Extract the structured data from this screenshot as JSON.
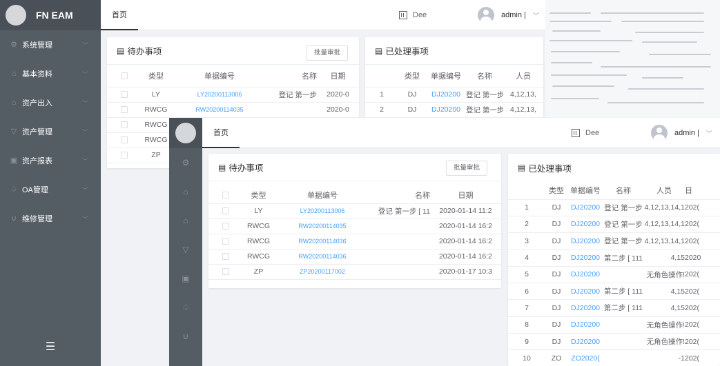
{
  "app": {
    "name": "FN EAM"
  },
  "sidebar": {
    "items": [
      {
        "label": "系统管理",
        "icon": "gear-icon"
      },
      {
        "label": "基本资料",
        "icon": "bag-icon"
      },
      {
        "label": "资产出入",
        "icon": "bag-out-icon"
      },
      {
        "label": "资产管理",
        "icon": "cart-icon"
      },
      {
        "label": "资产报表",
        "icon": "report-icon"
      },
      {
        "label": "OA管理",
        "icon": "bell-icon"
      },
      {
        "label": "维修管理",
        "icon": "magnet-icon"
      }
    ],
    "toggle_icon": "menu-fold-icon"
  },
  "header": {
    "tab": "首页",
    "dept": "Dee",
    "user": "admin |",
    "caret": "﹀"
  },
  "todo": {
    "title": "待办事项",
    "batch_button": "批量审批",
    "columns": [
      "类型",
      "单据编号",
      "名称",
      "日期"
    ],
    "rows": [
      {
        "type": "LY",
        "code": "LY20200113006",
        "name": "登记 第一步 [ 11",
        "date": "2020-01-14 11:2"
      },
      {
        "type": "RWCG",
        "code": "RW20200114035",
        "name": "",
        "date": "2020-01-14 16:2"
      },
      {
        "type": "RWCG",
        "code": "RW20200114036",
        "name": "",
        "date": "2020-01-14 16:2"
      },
      {
        "type": "RWCG",
        "code": "RW20200114036",
        "name": "",
        "date": "2020-01-14 16:2"
      },
      {
        "type": "ZP",
        "code": "ZP20200117002",
        "name": "",
        "date": "2020-01-17 10:3"
      }
    ],
    "back_rows": [
      {
        "type": "LY",
        "code": "LY20200113006",
        "name": "登记 第一步",
        "date": "2020-0"
      },
      {
        "type": "RWCG",
        "code": "RW20200114035",
        "name": "",
        "date": "2020-0"
      },
      {
        "type": "RWCG"
      },
      {
        "type": "RWCG"
      },
      {
        "type": "ZP"
      }
    ],
    "back_columns": [
      "类型",
      "单据编号",
      "名称",
      "日期"
    ]
  },
  "done": {
    "title": "已处理事项",
    "columns": [
      "类型",
      "单据编号",
      "名称",
      "人员",
      "日"
    ],
    "rows": [
      {
        "idx": "1",
        "type": "DJ",
        "code": "DJ20200",
        "name": "登记 第一步",
        "person": "4,12,13,14,1",
        "date": "202("
      },
      {
        "idx": "2",
        "type": "DJ",
        "code": "DJ20200",
        "name": "登记 第一步",
        "person": "4,12,13,14,1",
        "date": "202("
      },
      {
        "idx": "3",
        "type": "DJ",
        "code": "DJ20200",
        "name": "登记 第一步",
        "person": "4,12,13,14,1",
        "date": "202("
      },
      {
        "idx": "4",
        "type": "DJ",
        "code": "DJ20200",
        "name": "第二步 [ 111",
        "person": "4,15",
        "date": "2020"
      },
      {
        "idx": "5",
        "type": "DJ",
        "code": "DJ20200",
        "name": "",
        "person": "无角色操作!",
        "date": "202("
      },
      {
        "idx": "6",
        "type": "DJ",
        "code": "DJ20200",
        "name": "第二步 [ 111",
        "person": "4,15",
        "date": "202("
      },
      {
        "idx": "7",
        "type": "DJ",
        "code": "DJ20200",
        "name": "第二步 [ 111",
        "person": "4,15",
        "date": "202("
      },
      {
        "idx": "8",
        "type": "DJ",
        "code": "DJ20200",
        "name": "",
        "person": "无角色操作!",
        "date": "202("
      },
      {
        "idx": "9",
        "type": "DJ",
        "code": "DJ20200",
        "name": "",
        "person": "无角色操作!",
        "date": "202("
      },
      {
        "idx": "10",
        "type": "ZO",
        "code": "ZO2020(",
        "name": "",
        "person": "-1",
        "date": "202("
      }
    ],
    "back_columns": [
      "类型",
      "单据编号",
      "名称",
      "人员"
    ],
    "back_rows": [
      {
        "idx": "1",
        "type": "DJ",
        "code": "DJ20200",
        "name": "登记 第一步",
        "person": "4,12,13,"
      },
      {
        "idx": "2",
        "type": "DJ",
        "code": "DJ20200",
        "name": "登记 第一步",
        "person": "4,12,13,"
      }
    ]
  }
}
